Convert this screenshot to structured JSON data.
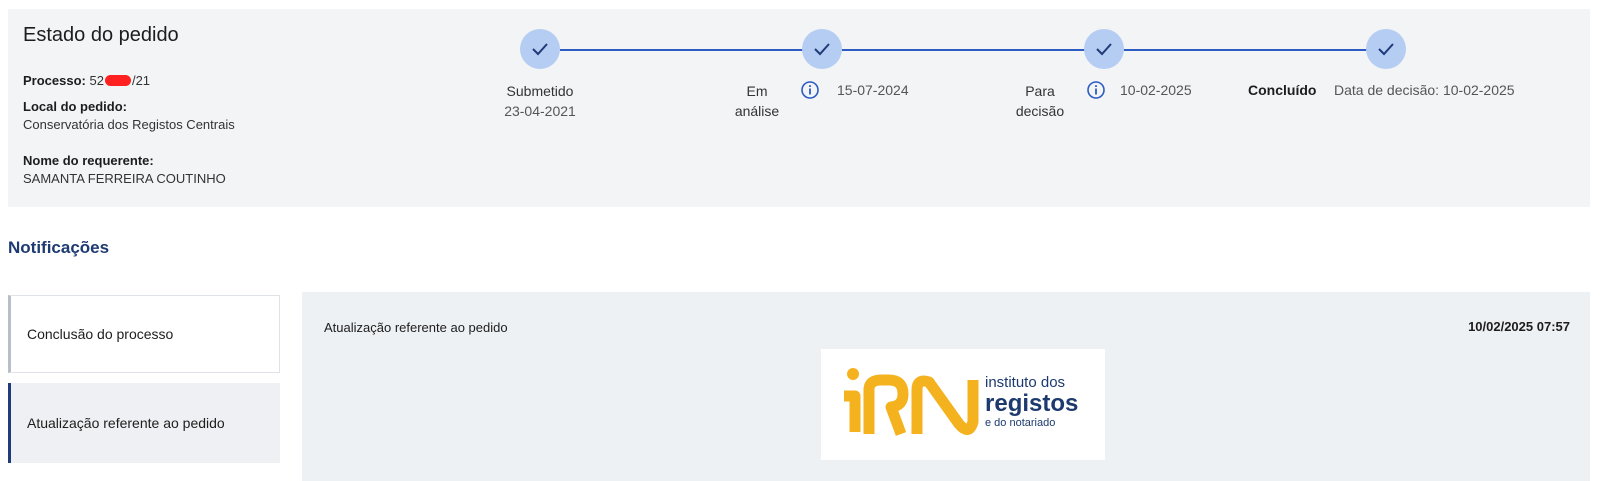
{
  "status": {
    "title": "Estado do pedido",
    "processo_label": "Processo:",
    "processo_prefix": "52",
    "processo_suffix": "/21",
    "local_label": "Local do pedido:",
    "local_value": "Conservatória dos Registos Centrais",
    "nome_label": "Nome do requerente:",
    "nome_value": "SAMANTA FERREIRA COUTINHO",
    "steps": [
      {
        "label": "Submetido",
        "date": "23-04-2021"
      },
      {
        "label_line1": "Em",
        "label_line2": "análise",
        "date": "15-07-2024"
      },
      {
        "label_line1": "Para",
        "label_line2": "decisão",
        "date": "10-02-2025"
      },
      {
        "label": "Concluído",
        "date": "Data de decisão: 10-02-2025"
      }
    ]
  },
  "notifications": {
    "title": "Notificações",
    "items": [
      {
        "label": "Conclusão do processo"
      },
      {
        "label": "Atualização referente ao pedido"
      }
    ],
    "detail": {
      "title": "Atualização referente ao pedido",
      "timestamp": "10/02/2025 07:57"
    },
    "logo": {
      "line1": "instituto dos",
      "line2": "registos",
      "line3": "e do notariado"
    }
  },
  "colors": {
    "accent": "#2d5bc3",
    "step_circle": "#b5cdf3",
    "logo_yellow": "#f5b21f",
    "logo_navy": "#1d3a6e"
  },
  "icons": [
    "check-icon",
    "info-icon",
    "irn-logo"
  ]
}
